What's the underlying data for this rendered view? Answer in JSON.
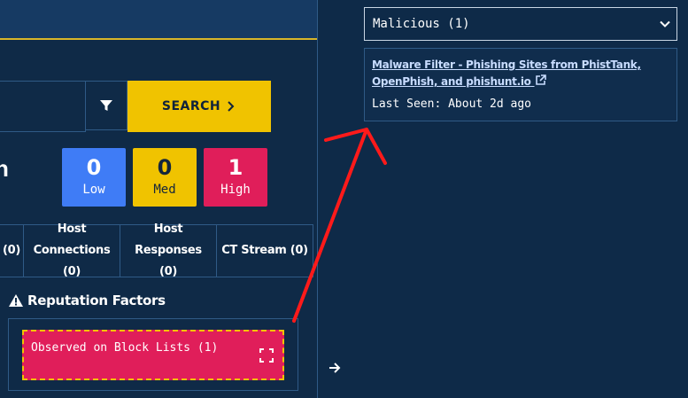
{
  "search": {
    "button_label": "SEARCH"
  },
  "scores": {
    "low": {
      "value": "0",
      "label": "Low",
      "color": "#3f7cf6"
    },
    "med": {
      "value": "0",
      "label": "Med",
      "color": "#f0c300"
    },
    "high": {
      "value": "1",
      "label": "High",
      "color": "#e01e5a"
    }
  },
  "tabs": [
    {
      "line1": "(0)",
      "line2": ""
    },
    {
      "line1": "Host",
      "line2": "Connections (0)"
    },
    {
      "line1": "Host Responses",
      "line2": "(0)"
    },
    {
      "line1": "CT Stream (0)",
      "line2": ""
    }
  ],
  "reputation": {
    "title": "Reputation Factors",
    "blocklist_label": "Observed on Block Lists (1)"
  },
  "detail": {
    "select_value": "Malicious (1)",
    "source_link": "Malware Filter - Phishing Sites from PhistTank, OpenPhish, and phishunt.io",
    "last_seen": "Last Seen: About 2d ago"
  },
  "colors": {
    "accent_yellow": "#f0c300",
    "annotation_red": "#ff0000",
    "background": "#0f2a47"
  },
  "icons": [
    "filter-icon",
    "chevron-right-icon",
    "warning-icon",
    "expand-icon",
    "arrow-right-icon",
    "chevron-down-icon",
    "external-link-icon"
  ]
}
